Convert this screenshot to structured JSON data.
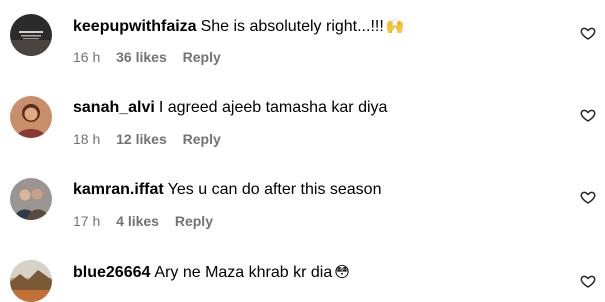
{
  "comments": [
    {
      "username": "keepupwithfaiza",
      "text": "She is absolutely right...!!!",
      "emoji": "🙌",
      "time": "16 h",
      "likes": "36 likes",
      "reply": "Reply",
      "avatar_icon": "profile-photo-dark"
    },
    {
      "username": "sanah_alvi",
      "text": "I agreed ajeeb tamasha kar diya",
      "emoji": "",
      "time": "18 h",
      "likes": "12 likes",
      "reply": "Reply",
      "avatar_icon": "profile-photo-woman"
    },
    {
      "username": "kamran.iffat",
      "text": "Yes u can do after this season",
      "emoji": "",
      "time": "17 h",
      "likes": "4 likes",
      "reply": "Reply",
      "avatar_icon": "profile-photo-couple"
    },
    {
      "username": "blue26664",
      "text": "Ary ne Maza khrab kr dia",
      "emoji": "😳",
      "time": "",
      "likes": "",
      "reply": "",
      "avatar_icon": "profile-photo-outdoor"
    }
  ],
  "colors": {
    "meta": "#737373",
    "text": "#000000"
  }
}
